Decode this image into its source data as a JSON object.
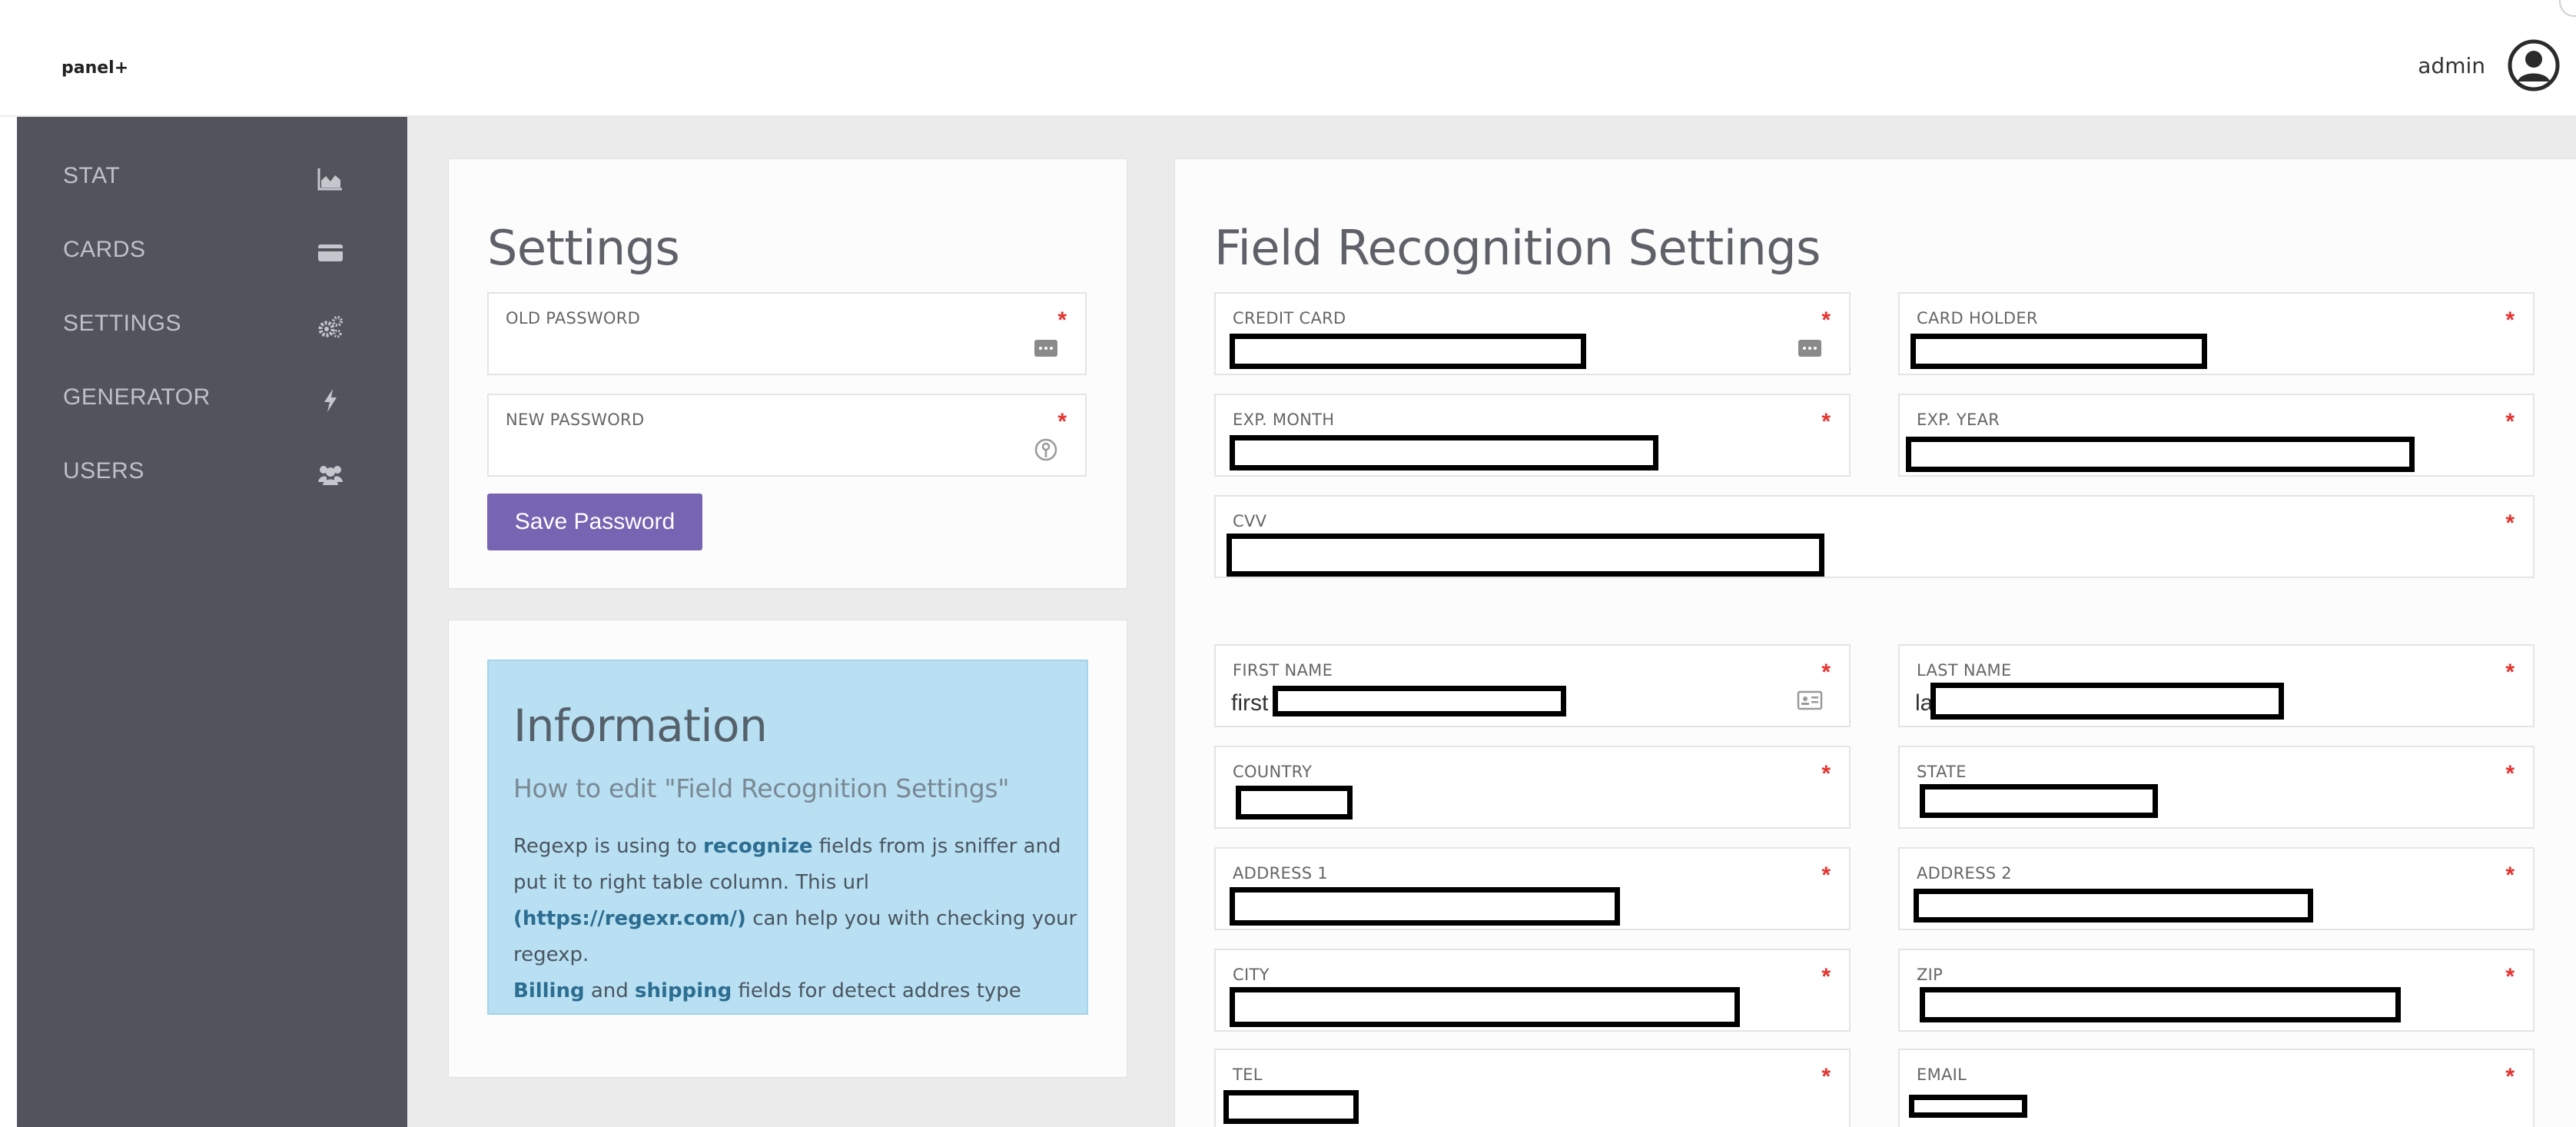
{
  "app": {
    "brand": "panel+"
  },
  "user": {
    "name": "admin"
  },
  "sidebar": {
    "items": [
      {
        "label": "STAT",
        "icon": "area-chart-icon"
      },
      {
        "label": "CARDS",
        "icon": "credit-card-icon"
      },
      {
        "label": "SETTINGS",
        "icon": "gears-icon"
      },
      {
        "label": "GENERATOR",
        "icon": "bolt-icon"
      },
      {
        "label": "USERS",
        "icon": "users-icon"
      }
    ]
  },
  "settings": {
    "title": "Settings",
    "old_password": {
      "label": "OLD PASSWORD",
      "value": ""
    },
    "new_password": {
      "label": "NEW PASSWORD",
      "value": ""
    },
    "save_button": "Save Password"
  },
  "information": {
    "title": "Information",
    "subtitle": "How to edit \"Field Recognition Settings\"",
    "text1": "Regexp is using to ",
    "bold1": "recognize",
    "text2": " fields from js sniffer and put it to right table column. This url ",
    "bold2": "(https://regexr.com/)",
    "text3": " can help you with checking your regexp.",
    "bold3": "Billing",
    "text4": " and ",
    "bold4": "shipping",
    "text5": " fields for detect addres type"
  },
  "field_recognition": {
    "title": "Field Recognition Settings",
    "required_marker": "*",
    "fields": {
      "credit_card": {
        "label": "CREDIT CARD",
        "value": ""
      },
      "card_holder": {
        "label": "CARD HOLDER",
        "value": ""
      },
      "exp_month": {
        "label": "EXP. MONTH",
        "value": ""
      },
      "exp_year": {
        "label": "EXP. YEAR",
        "value": ""
      },
      "cvv": {
        "label": "CVV",
        "value": ""
      },
      "first_name": {
        "label": "FIRST NAME",
        "value": "first"
      },
      "last_name": {
        "label": "LAST NAME",
        "value": "la"
      },
      "country": {
        "label": "COUNTRY",
        "value": ""
      },
      "state": {
        "label": "STATE",
        "value": ""
      },
      "address1": {
        "label": "ADDRESS 1",
        "value": ""
      },
      "address2": {
        "label": "ADDRESS 2",
        "value": ""
      },
      "city": {
        "label": "CITY",
        "value": ""
      },
      "zip": {
        "label": "ZIP",
        "value": ""
      },
      "tel": {
        "label": "TEL",
        "value": ""
      },
      "email": {
        "label": "EMAIL",
        "value": ""
      }
    }
  },
  "colors": {
    "sidebar_bg": "#52545d",
    "accent_button": "#7764b3",
    "info_bg": "#b8e0f2",
    "required": "#e3342f"
  }
}
